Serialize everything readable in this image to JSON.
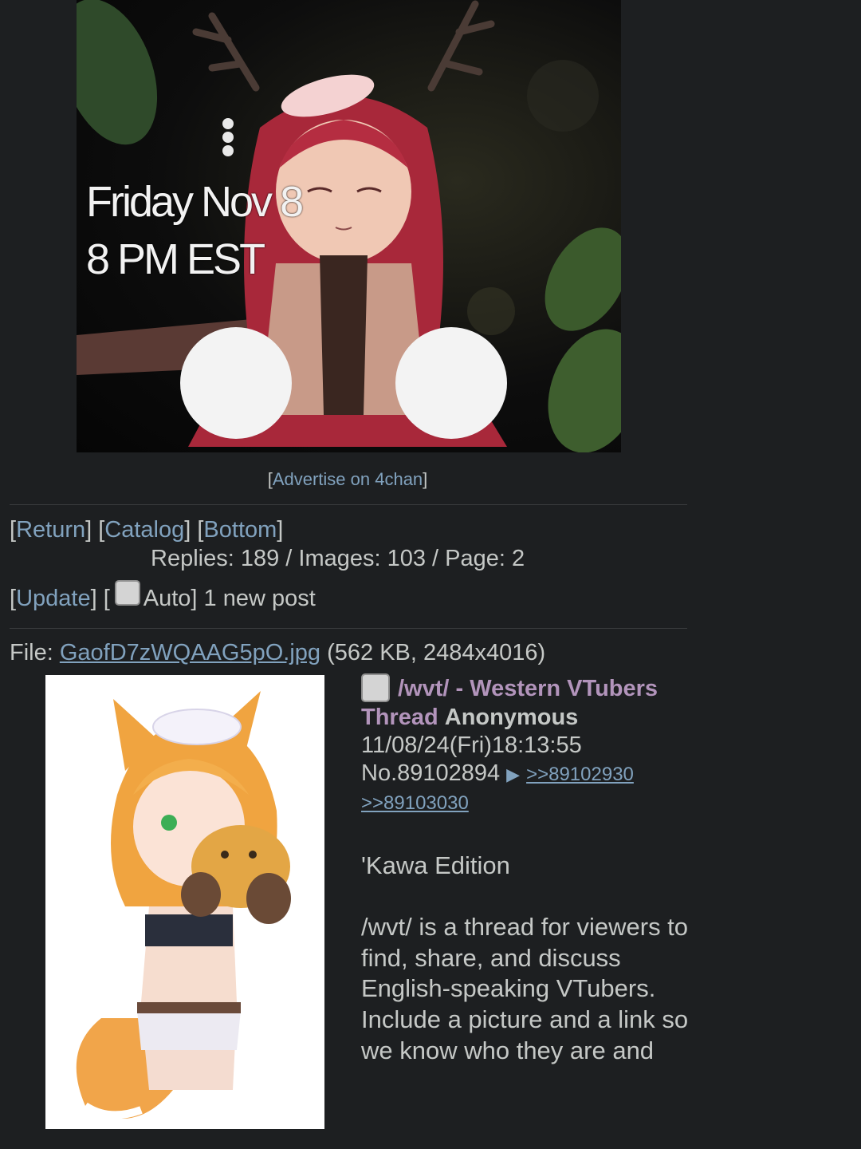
{
  "banner": {
    "line1": "Friday Nov 8",
    "line2": "8 PM EST"
  },
  "advert": {
    "open": "[",
    "label": "Advertise on 4chan",
    "close": "]"
  },
  "nav": {
    "return_label": "Return",
    "catalog_label": "Catalog",
    "bottom_label": "Bottom"
  },
  "stats": {
    "text": "Replies: 189 / Images: 103 / Page: 2"
  },
  "updater": {
    "update_label": "Update",
    "auto_label": "Auto]",
    "new_posts": "1 new post"
  },
  "file": {
    "prefix": "File: ",
    "filename": "GaofD7zWQAAG5pO.jpg",
    "meta": " (562 KB, 2484x4016)"
  },
  "post": {
    "subject": "/wvt/ - Western VTubers Thread",
    "name": "Anonymous",
    "datetime": "11/08/24(Fri)18:13:55",
    "number": "No.89102894",
    "arrow": "▶",
    "backlinks": [
      ">>89102930",
      ">>89103030"
    ],
    "body": [
      "'Kawa Edition",
      "",
      "/wvt/ is a thread for viewers to find, share, and discuss English-speaking VTubers.",
      "Include a picture and a link so we know who they are and"
    ]
  },
  "colors": {
    "background": "#1d1f21",
    "text": "#c5c8c6",
    "link": "#81a2be",
    "subject": "#b294bb"
  }
}
